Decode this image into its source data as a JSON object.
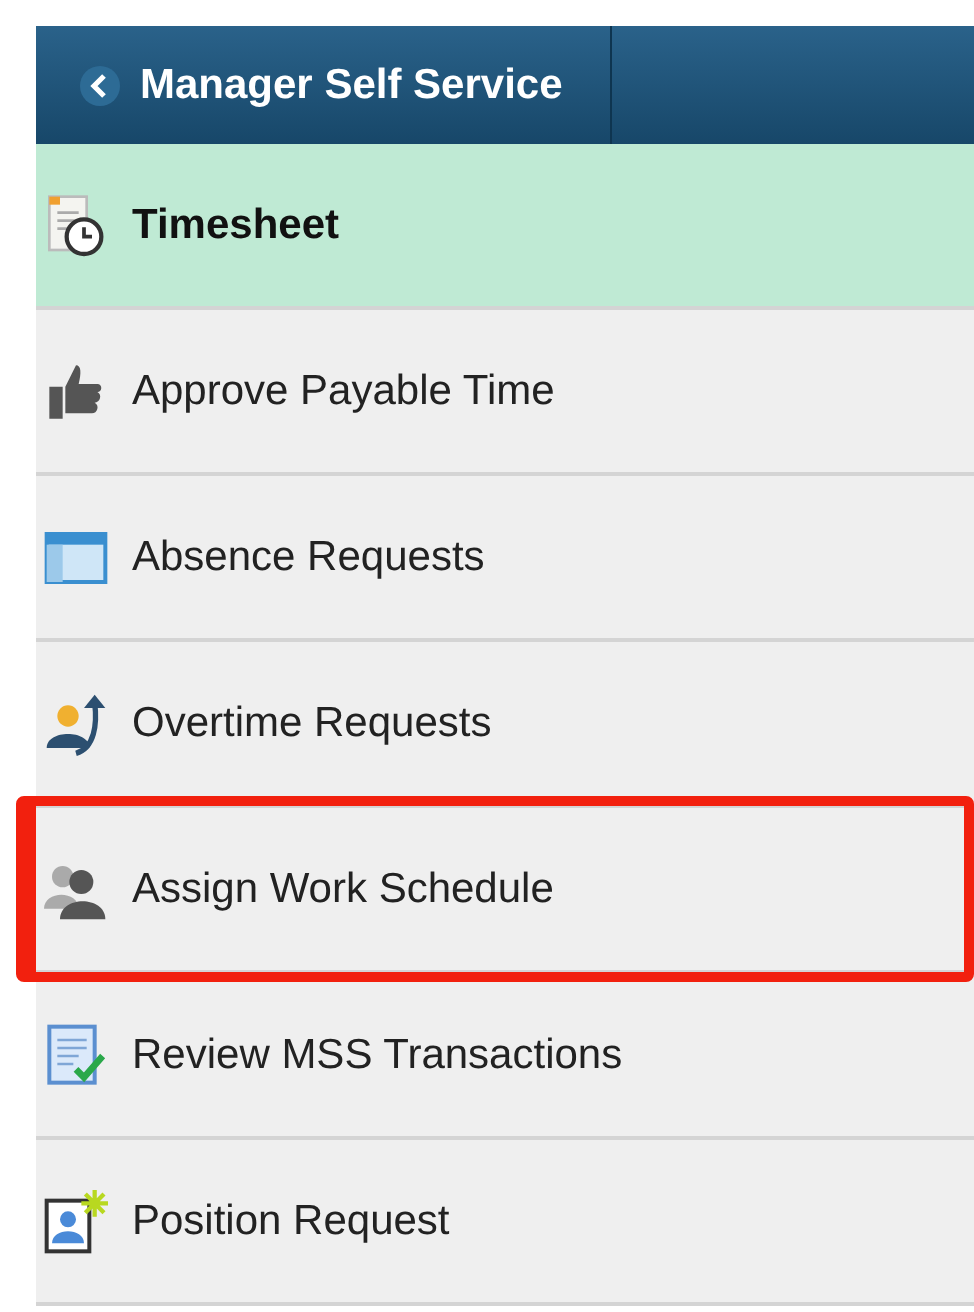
{
  "header": {
    "title": "Manager Self Service"
  },
  "items": [
    {
      "label": "Timesheet",
      "selected": true,
      "highlighted": false
    },
    {
      "label": "Approve Payable Time",
      "selected": false,
      "highlighted": false
    },
    {
      "label": "Absence Requests",
      "selected": false,
      "highlighted": false
    },
    {
      "label": "Overtime Requests",
      "selected": false,
      "highlighted": false
    },
    {
      "label": "Assign Work Schedule",
      "selected": false,
      "highlighted": true
    },
    {
      "label": "Review MSS Transactions",
      "selected": false,
      "highlighted": false
    },
    {
      "label": "Position Request",
      "selected": false,
      "highlighted": false
    }
  ]
}
